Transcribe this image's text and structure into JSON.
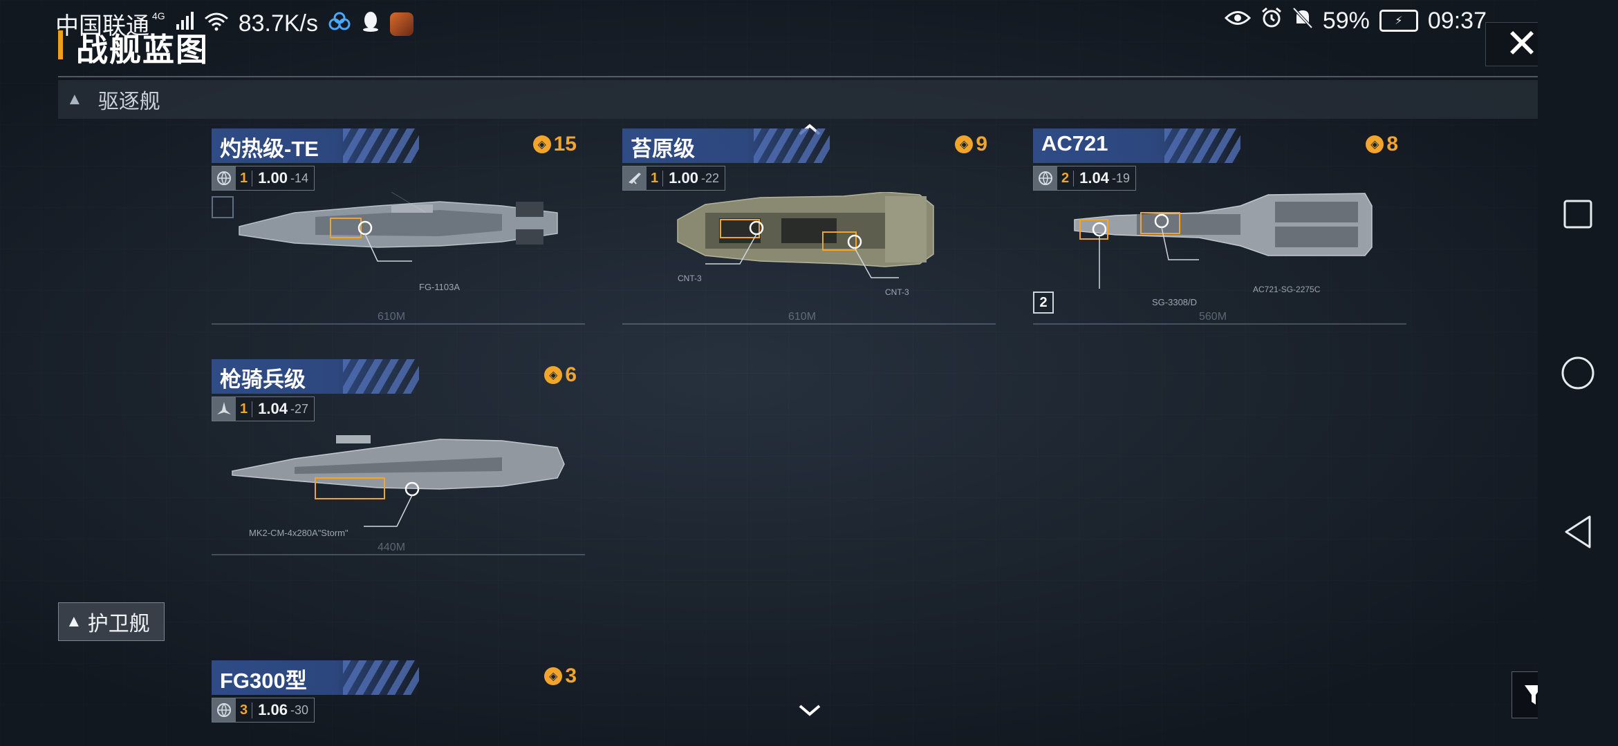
{
  "status_bar": {
    "carrier": "中国联通",
    "network_type": "4G",
    "speed": "83.7K/s",
    "battery": "59%",
    "time": "09:37"
  },
  "page": {
    "title": "战舰蓝图",
    "close_label": "✕"
  },
  "sections": [
    {
      "label": "驱逐舰"
    },
    {
      "label": "护卫舰"
    }
  ],
  "ships": [
    {
      "name": "灼热级-TE",
      "cost": "15",
      "tier": "1",
      "version": "1.00",
      "level": "-14",
      "type_icon": "globe-icon"
    },
    {
      "name": "苔原级",
      "cost": "9",
      "tier": "1",
      "version": "1.00",
      "level": "-22",
      "type_icon": "faction-icon"
    },
    {
      "name": "AC721",
      "cost": "8",
      "tier": "2",
      "version": "1.04",
      "level": "-19",
      "type_icon": "globe-icon",
      "badge": "2"
    },
    {
      "name": "枪骑兵级",
      "cost": "6",
      "tier": "1",
      "version": "1.04",
      "level": "-27",
      "type_icon": "jet-icon"
    },
    {
      "name": "FG300型",
      "cost": "3",
      "tier": "3",
      "version": "1.06",
      "level": "-30",
      "type_icon": "globe-icon"
    }
  ],
  "ship_details": {
    "ship0_weapon": "FG-1103A",
    "ship0_length": "610M",
    "ship1_weapon_a": "CNT-3",
    "ship1_weapon_b": "CNT-3",
    "ship1_length": "610M",
    "ship2_weapon_a": "SG-3308/D",
    "ship2_weapon_b": "AC721-SG-2275C",
    "ship2_length": "560M",
    "ship3_weapon": "MK2-CM-4x280A\"Storm\"",
    "ship3_length": "440M"
  },
  "colors": {
    "accent": "#f2a52a",
    "header_blue": "#304e8c",
    "background": "#1b232d"
  }
}
